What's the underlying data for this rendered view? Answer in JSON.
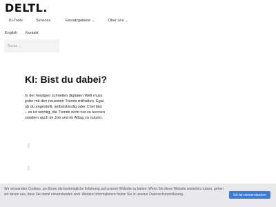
{
  "site": {
    "logo": "DELTL."
  },
  "nav": {
    "row1": [
      {
        "label": "KI-Tools",
        "has_dropdown": false
      },
      {
        "label": "Services",
        "has_dropdown": false
      },
      {
        "label": "Einsatzgebiete",
        "has_dropdown": true
      },
      {
        "label": "Über uns",
        "has_dropdown": true
      }
    ],
    "row2": [
      {
        "label": "English"
      },
      {
        "label": "Kontakt"
      }
    ],
    "dropdown_icon": "chevron-down-icon"
  },
  "search": {
    "placeholder": "Suche ..."
  },
  "article": {
    "headline": "KI: Bist du dabei?",
    "paragraph": "In der heutigen schnellen digitalen Welt muss jeder mit den neuesten Trends mithalten. Egal ob du angestellt, selbstständig oder Chef bist – es ist wichtig, die Trends nicht nur zu kennen sondern auch im Job und im Alltag zu nutzen."
  },
  "cookie_banner": {
    "text": "Wir verwenden Cookies, um Ihnen die bestmögliche Erfahrung auf unserer Website zu bieten. Wenn Sie diese Website weiterhin nutzen, gehen wir davon aus, dass Sie damit einverstanden sind. Weitere Informationen finden Sie in unserer Datenschutzerklärung.",
    "accept_label": "Ich bin einverstanden",
    "accept_color": "#3d7bd9"
  }
}
